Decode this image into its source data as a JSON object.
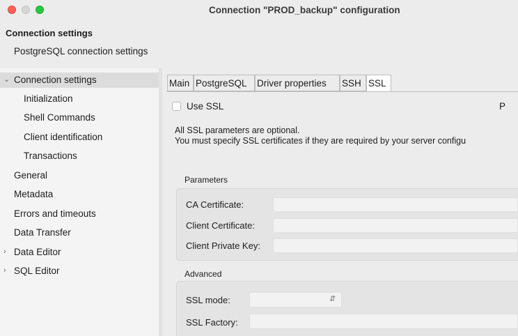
{
  "window": {
    "title": "Connection \"PROD_backup\" configuration"
  },
  "header": {
    "title": "Connection settings",
    "subtitle": "PostgreSQL connection settings"
  },
  "sidebar": {
    "items": [
      {
        "label": "Connection settings",
        "expanded": true,
        "selected": true
      },
      {
        "label": "Initialization"
      },
      {
        "label": "Shell Commands"
      },
      {
        "label": "Client identification"
      },
      {
        "label": "Transactions"
      },
      {
        "label": "General"
      },
      {
        "label": "Metadata"
      },
      {
        "label": "Errors and timeouts"
      },
      {
        "label": "Data Transfer"
      },
      {
        "label": "Data Editor",
        "expanded": false
      },
      {
        "label": "SQL Editor",
        "expanded": false
      }
    ]
  },
  "tabs": [
    {
      "label": "Main"
    },
    {
      "label": "PostgreSQL"
    },
    {
      "label": "Driver properties"
    },
    {
      "label": "SSH"
    },
    {
      "label": "SSL",
      "active": true
    }
  ],
  "ssl": {
    "use_ssl_label": "Use SSL",
    "use_ssl_checked": false,
    "cut_right_label": "P",
    "info_line1": "All SSL parameters are optional.",
    "info_line2": "You must specify SSL certificates if they are required by your server configu",
    "parameters": {
      "title": "Parameters",
      "ca_label": "CA Certificate:",
      "ca_value": "",
      "client_cert_label": "Client Certificate:",
      "client_cert_value": "",
      "client_key_label": "Client Private Key:",
      "client_key_value": ""
    },
    "advanced": {
      "title": "Advanced",
      "ssl_mode_label": "SSL mode:",
      "ssl_mode_value": "",
      "ssl_factory_label": "SSL Factory:",
      "ssl_factory_value": ""
    }
  },
  "colors": {
    "close": "#fe5f57",
    "minimize": "#d6d6d6",
    "zoom": "#28c840",
    "selection": "#dcdcdc"
  }
}
